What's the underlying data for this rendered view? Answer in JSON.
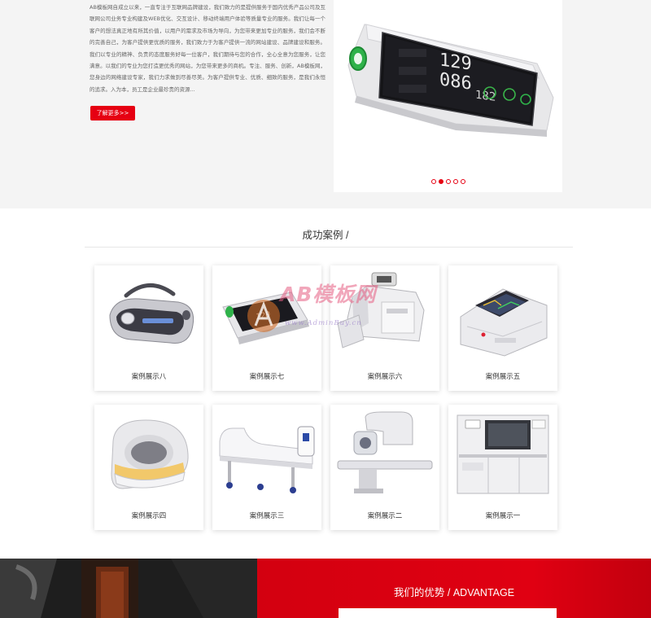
{
  "about": {
    "paragraph": "AB模板网自成立以来，一直专注于互联网品牌建设，我们致力的是提供服务于国内优秀产品公司及互联网公司业务专业构建及WEB优化、交互设计、移动终端用户体验等质量专业的服务。我们让每一个客户的想法真正地有所其价值，以用户的需求及市场为导向，为您带来更加专业的服务，我们会不断的完善自己，为客户提供更优质的服务，我们致力于为客户提供一流的网站建设、品牌建设和服务。我们以专业的精神、负责的态度服务好每一位客户，我们期待与您的合作，全心全意为您服务，让您满意。以我们的专业为您打造更优秀的网站，为您带来更多的商机。专注、服务、创新，AB模板网，您身边的网络建设专家，我们力求做到尽善尽美。为客户提供专业、优质、细致的服务，是我们永恒的追求。入为本，员工是企业最珍贵的资源...",
    "more_button": "了解更多>>",
    "slider_dots": 5,
    "slider_active_index": 1
  },
  "cases": {
    "title": "成功案例 /",
    "items": [
      {
        "label": "案例展示八"
      },
      {
        "label": "案例展示七"
      },
      {
        "label": "案例展示六"
      },
      {
        "label": "案例展示五"
      },
      {
        "label": "案例展示四"
      },
      {
        "label": "案例展示三"
      },
      {
        "label": "案例展示二"
      },
      {
        "label": "案例展示一"
      }
    ]
  },
  "watermark": {
    "brand": "AB模板网",
    "url": "www.AdminBuy.cn"
  },
  "advantage": {
    "title": "我们的优势 / ADVANTAGE"
  },
  "colors": {
    "accent": "#e60012",
    "section_bg": "#f4f4f4",
    "dark_bg": "#1b1b1b"
  }
}
